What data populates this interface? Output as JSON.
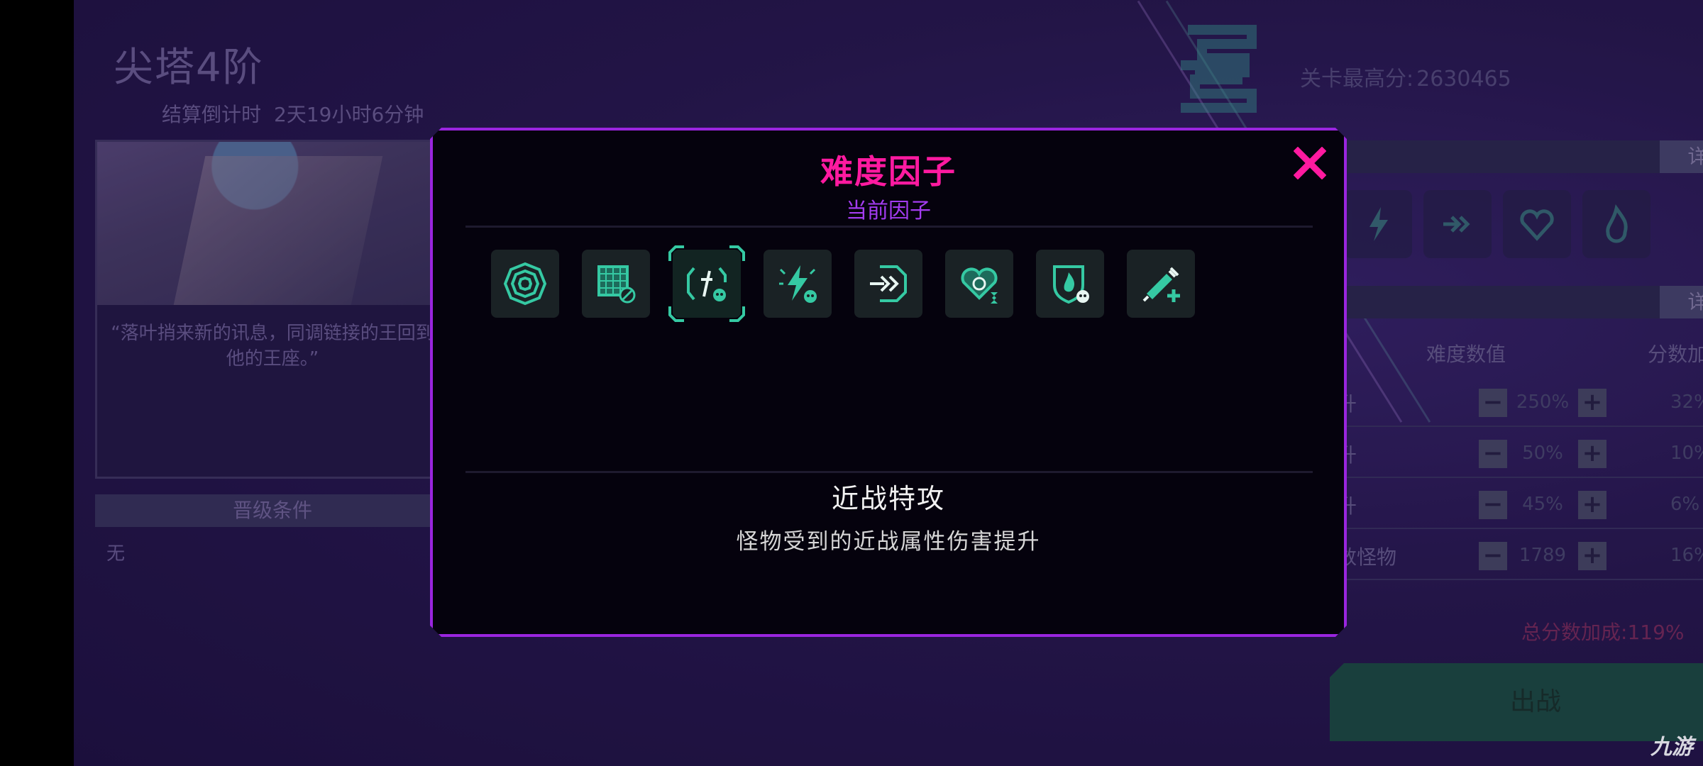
{
  "background": {
    "stage_title": "尖塔4阶",
    "countdown_label": "结算倒计时",
    "countdown_value": "2天19小时6分钟",
    "quote": "“落叶捎来新的讯息，同调链接的王回到他的王座。”",
    "advance_condition_header": "晋级条件",
    "advance_condition_value": "无",
    "best_score_label": "关卡最高分:",
    "best_score_value": "2630465",
    "detail_label_1": "详细",
    "detail_label_2": "详细",
    "col_difficulty": "难度数值",
    "col_bonus": "分数加成",
    "rows": [
      {
        "label": "升",
        "value": "250%",
        "bonus": "32%"
      },
      {
        "label": "升",
        "value": "50%",
        "bonus": "10%"
      },
      {
        "label": "升",
        "value": "45%",
        "bonus": "6%"
      },
      {
        "label": "数怪物",
        "value": "1789",
        "bonus": "16%"
      }
    ],
    "total_bonus_label": "总分数加成:",
    "total_bonus_value": "119%",
    "go_button": "出战",
    "watermark": "九游"
  },
  "modal": {
    "title": "难度因子",
    "subtitle": "当前因子",
    "selected_name": "近战特攻",
    "selected_desc": "怪物受到的近战属性伤害提升",
    "factors": [
      {
        "icon": "concentric-target-icon"
      },
      {
        "icon": "grid-block-icon"
      },
      {
        "icon": "melee-skull-icon",
        "selected": true
      },
      {
        "icon": "lightning-skull-icon"
      },
      {
        "icon": "dash-arrows-icon"
      },
      {
        "icon": "heart-hourglass-icon"
      },
      {
        "icon": "fire-shield-skull-icon"
      },
      {
        "icon": "syringe-plus-icon"
      }
    ],
    "colors": {
      "border": "#9a25df",
      "title": "#ff1aa0",
      "subtitle": "#a33cf0",
      "icon": "#35c9a3"
    }
  }
}
